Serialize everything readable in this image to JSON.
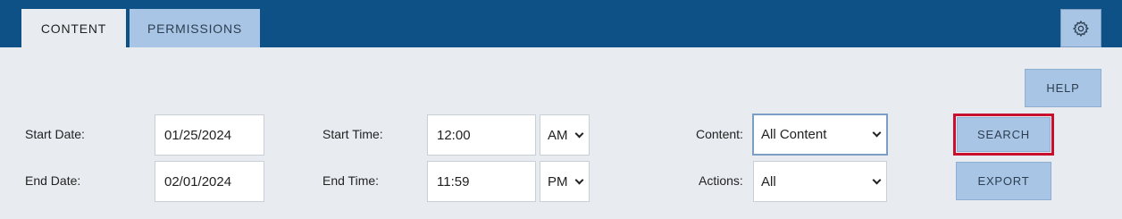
{
  "tabs": [
    {
      "label": "CONTENT",
      "active": true
    },
    {
      "label": "PERMISSIONS",
      "active": false
    }
  ],
  "settings_icon": "gear-icon",
  "buttons": {
    "help": "HELP",
    "search": "SEARCH",
    "export": "EXPORT"
  },
  "filters": {
    "start_date": {
      "label": "Start Date:",
      "value": "01/25/2024"
    },
    "end_date": {
      "label": "End Date:",
      "value": "02/01/2024"
    },
    "start_time": {
      "label": "Start Time:",
      "value": "12:00",
      "meridiem": "AM"
    },
    "end_time": {
      "label": "End Time:",
      "value": "11:59",
      "meridiem": "PM"
    },
    "content": {
      "label": "Content:",
      "value": "All Content"
    },
    "actions": {
      "label": "Actions:",
      "value": "All"
    }
  },
  "colors": {
    "header": "#0d5186",
    "button": "#a8c5e6",
    "highlight": "#c8102e",
    "background": "#e8ecf1"
  }
}
